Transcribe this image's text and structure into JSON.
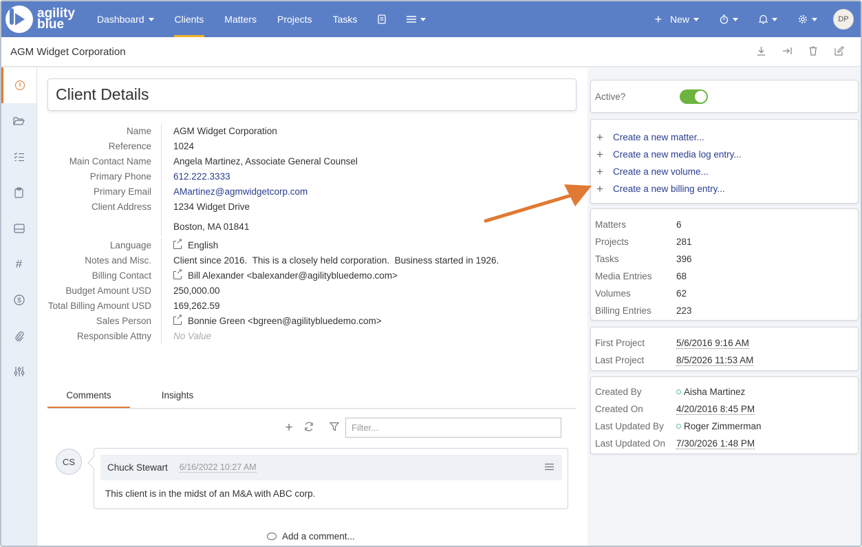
{
  "navbar": {
    "logo_line1": "agility",
    "logo_line2": "blue",
    "items": [
      {
        "label": "Dashboard",
        "dropdown": true
      },
      {
        "label": "Clients",
        "active": true
      },
      {
        "label": "Matters"
      },
      {
        "label": "Projects"
      },
      {
        "label": "Tasks"
      }
    ],
    "new_label": "New",
    "user_initials": "DP"
  },
  "titlebar": {
    "title": "AGM Widget Corporation"
  },
  "client_details": {
    "heading": "Client Details",
    "rows": [
      {
        "label": "Name",
        "value": "AGM Widget Corporation"
      },
      {
        "label": "Reference",
        "value": "1024"
      },
      {
        "label": "Main Contact Name",
        "value": "Angela Martinez, Associate General Counsel"
      },
      {
        "label": "Primary Phone",
        "value": "612.222.3333"
      },
      {
        "label": "Primary Email",
        "value": "AMartinez@agmwidgetcorp.com"
      },
      {
        "label": "Client Address",
        "value": "1234 Widget Drive",
        "value2": "Boston, MA 01841"
      },
      {
        "label": "Language",
        "value": "English"
      },
      {
        "label": "Notes and Misc.",
        "value": "Client since 2016.  This is a closely held corporation.  Business started in 1926."
      },
      {
        "label": "Billing Contact",
        "value": "Bill Alexander <balexander@agilitybluedemo.com>"
      },
      {
        "label": "Budget Amount USD",
        "value": "250,000.00"
      },
      {
        "label": "Total Billing Amount USD",
        "value": "169,262.59"
      },
      {
        "label": "Sales Person",
        "value": "Bonnie Green <bgreen@agilitybluedemo.com>"
      },
      {
        "label": "Responsible Attny",
        "value": "No Value"
      }
    ]
  },
  "tabs": [
    {
      "label": "Comments",
      "active": true
    },
    {
      "label": "Insights"
    }
  ],
  "comments": {
    "filter_placeholder": "Filter...",
    "items": [
      {
        "initials": "CS",
        "author": "Chuck Stewart",
        "date": "6/16/2022 10:27 AM",
        "text": "This client is in the midst of an M&A with ABC corp."
      }
    ],
    "add_label": "Add a comment..."
  },
  "right": {
    "active_label": "Active?",
    "active": true,
    "actions": [
      "Create a new matter...",
      "Create a new media log entry...",
      "Create a new volume...",
      "Create a new billing entry..."
    ],
    "stats": [
      {
        "label": "Matters",
        "value": "6"
      },
      {
        "label": "Projects",
        "value": "281"
      },
      {
        "label": "Tasks",
        "value": "396"
      },
      {
        "label": "Media Entries",
        "value": "68"
      },
      {
        "label": "Volumes",
        "value": "62"
      },
      {
        "label": "Billing Entries",
        "value": "223"
      }
    ],
    "dates": [
      {
        "label": "First Project",
        "value": "5/6/2016 9:16 AM"
      },
      {
        "label": "Last Project",
        "value": "8/5/2026 11:53 AM"
      }
    ],
    "meta": [
      {
        "label": "Created By",
        "value": "Aisha Martinez"
      },
      {
        "label": "Created On",
        "value": "4/20/2016 8:45 PM"
      },
      {
        "label": "Last Updated By",
        "value": "Roger Zimmerman"
      },
      {
        "label": "Last Updated On",
        "value": "7/30/2026 1:48 PM"
      }
    ]
  },
  "colors": {
    "navbar": "#5b7fc7",
    "accent": "#e07a32",
    "link": "#2a3d8f",
    "toggle_on": "#6cb33f",
    "nav_underline": "#f0b429"
  }
}
